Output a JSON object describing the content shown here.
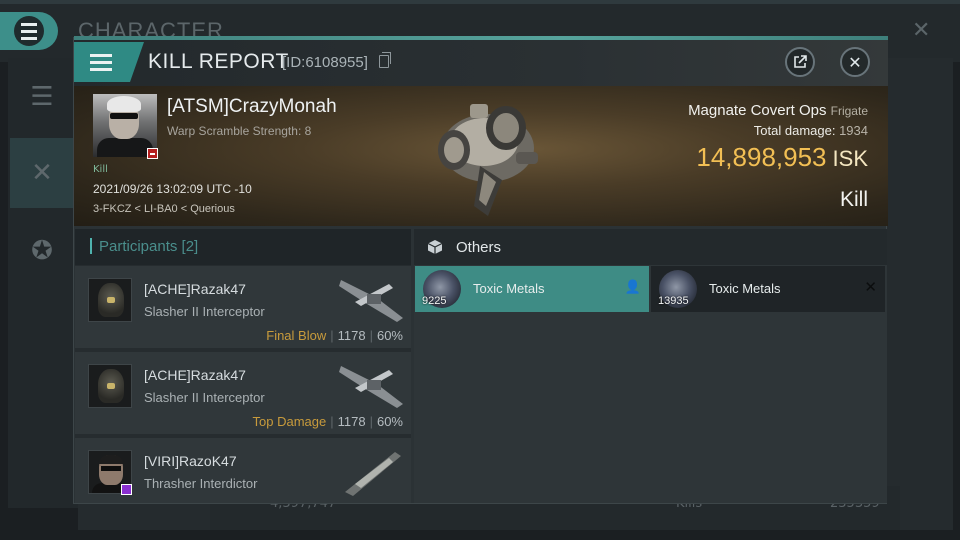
{
  "background": {
    "window_title": "CHARACTER",
    "bottom_text": [
      "4,397,747",
      "Kills",
      "235359"
    ]
  },
  "kill_report": {
    "title": "KILL REPORT",
    "id_label": "[ID:6108955]",
    "victim": {
      "name": "[ATSM]CrazyMonah",
      "warp_scramble": "Warp Scramble Strength: 8",
      "kill_tag": "Kill",
      "timestamp": "2021/09/26 13:02:09 UTC -10",
      "location": "3-FKCZ < LI-BA0 < Querious"
    },
    "ship": {
      "name": "Magnate Covert Ops",
      "class": "Frigate",
      "total_damage_label": "Total damage:",
      "total_damage": "1934",
      "isk_value": "14,898,953",
      "isk_unit": "ISK",
      "result": "Kill"
    },
    "participants": {
      "label": "Participants",
      "count": "[2]",
      "rows": [
        {
          "name": "[ACHE]Razak47",
          "ship": "Slasher II Interceptor",
          "tag": "Final Blow",
          "damage": "1178",
          "percent": "60%"
        },
        {
          "name": "[ACHE]Razak47",
          "ship": "Slasher II Interceptor",
          "tag": "Top Damage",
          "damage": "1178",
          "percent": "60%"
        },
        {
          "name": "[VIRI]RazoK47",
          "ship": "Thrasher Interdictor",
          "tag": "",
          "damage": "",
          "percent": ""
        }
      ]
    },
    "others": {
      "label": "Others",
      "items": [
        {
          "name": "Toxic Metals",
          "quantity": "9225",
          "status": "dropped"
        },
        {
          "name": "Toxic Metals",
          "quantity": "13935",
          "status": "destroyed"
        }
      ]
    }
  },
  "colors": {
    "accent": "#3e8c85",
    "isk": "#f2bf54",
    "tag": "#c89b3c"
  }
}
